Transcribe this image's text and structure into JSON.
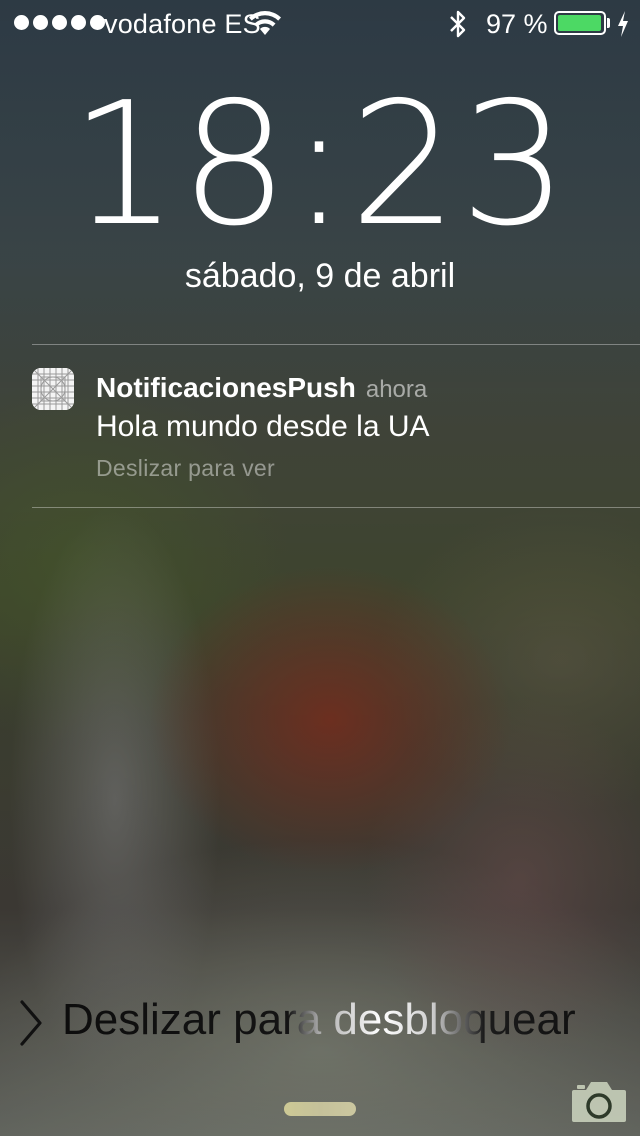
{
  "status_bar": {
    "signal_bars": 5,
    "carrier": "vodafone ES",
    "battery_percent": "97 %",
    "battery_level": 0.97,
    "battery_color": "#4cd964",
    "icons": [
      "wifi-icon",
      "bluetooth-icon",
      "battery-icon",
      "charging-bolt-icon"
    ]
  },
  "lock_screen": {
    "time": "18:23",
    "date": "sábado, 9 de abril"
  },
  "notification": {
    "app_name": "NotificacionesPush",
    "time": "ahora",
    "message": "Hola mundo desde la UA",
    "action_hint": "Deslizar para ver",
    "icon": "app-grid-icon"
  },
  "unlock": {
    "label": "Deslizar para desbloquear",
    "icon": "chevron-right-icon"
  },
  "bottom": {
    "icons": [
      "home-grabber",
      "camera-icon"
    ]
  }
}
